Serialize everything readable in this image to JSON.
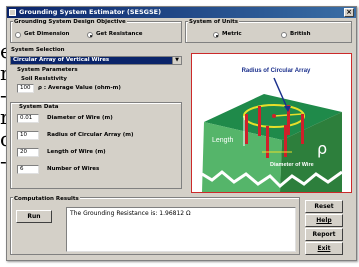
{
  "background_text": {
    "lines": [
      "e",
      "n",
      "-",
      "r",
      "d",
      "-"
    ]
  },
  "window": {
    "title": "Grounding System Estimator (SESGSE)",
    "close_glyph": "×"
  },
  "objective": {
    "group_label": "Grounding System Design Objective",
    "options": [
      {
        "label": "Get Dimension",
        "selected": false
      },
      {
        "label": "Get Resistance",
        "selected": true
      }
    ]
  },
  "units": {
    "group_label": "System of Units",
    "options": [
      {
        "label": "Metric",
        "selected": true
      },
      {
        "label": "British",
        "selected": false
      }
    ]
  },
  "system_selection": {
    "label": "System Selection",
    "selected": "Circular Array of Vertical Wires",
    "arrow": "▼"
  },
  "parameters": {
    "label": "System Parameters",
    "soil_label": "Soil Resistivity",
    "soil_value": "100",
    "soil_unit": "ρ : Average Value (ohm-m)"
  },
  "system_data": {
    "label": "System Data",
    "rows": [
      {
        "value": "0.01",
        "label": "Diameter of Wire (m)"
      },
      {
        "value": "10",
        "label": "Radius of Circular Array (m)"
      },
      {
        "value": "20",
        "label": "Length of Wire (m)"
      },
      {
        "value": "6",
        "label": "Number of Wires"
      }
    ]
  },
  "figure": {
    "radius_label": "Radius of Circular Array",
    "length_label": "Length",
    "diameter_label": "Diameter of Wire",
    "rho_label": "ρ",
    "colors": {
      "ground_top": "#1f8a4a",
      "ground_side": "#55b56a",
      "ground_dark": "#2d7f3c",
      "wires": "#d0202a",
      "ring": "#e6df2a",
      "arrow": "#1a2f8c"
    }
  },
  "computation": {
    "label": "Computation Results",
    "run_label": "Run",
    "result_text": "The Grounding Resistance is: 1.96812 Ω"
  },
  "actions": {
    "reset": "Reset",
    "help": "Help",
    "report": "Report",
    "exit": "Exit"
  }
}
